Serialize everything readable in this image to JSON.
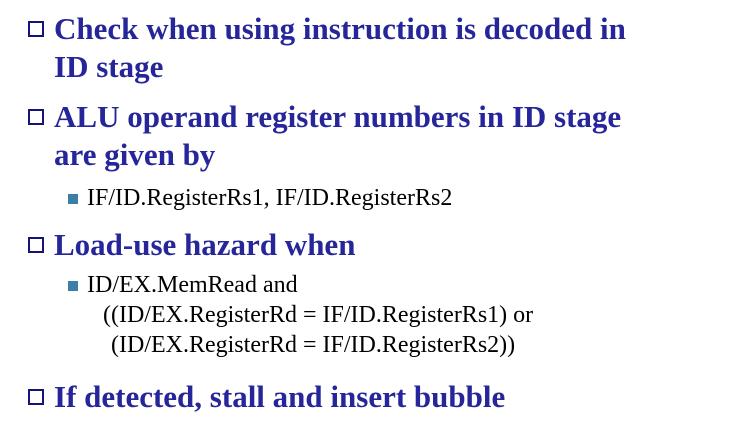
{
  "bullets": {
    "b1": {
      "line1": "Check when using instruction is decoded in",
      "line2": "ID stage"
    },
    "b2": {
      "line1": "ALU operand register numbers in ID stage",
      "line2": "are given by"
    },
    "b2_sub": {
      "line1": "IF/ID.RegisterRs1, IF/ID.RegisterRs2"
    },
    "b3": {
      "line1": "Load-use hazard when"
    },
    "b3_sub": {
      "line1": "ID/EX.MemRead and",
      "line2": "((ID/EX.RegisterRd = IF/ID.RegisterRs1) or",
      "line3": "(ID/EX.RegisterRd = IF/ID.RegisterRs2))"
    },
    "b4": {
      "line1": "If detected, stall and insert bubble"
    }
  },
  "colors": {
    "heading_text": "#26269a",
    "hollow_marker": "#14147a",
    "filled_marker": "#3a7fa8",
    "body_text": "#000000"
  }
}
